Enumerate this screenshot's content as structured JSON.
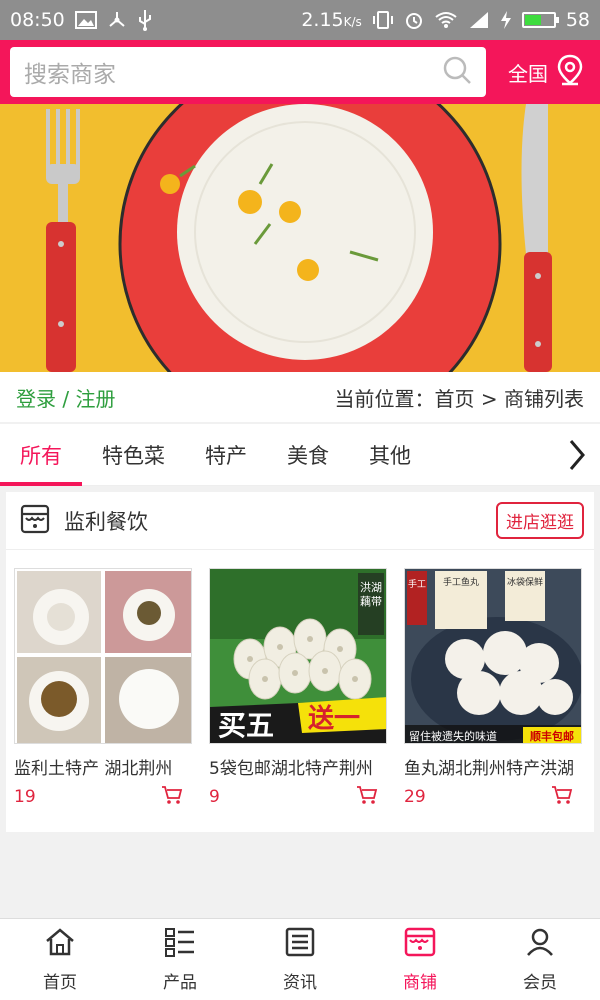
{
  "status_bar": {
    "time": "08:50",
    "speed": "2.15",
    "speed_unit": "K/s",
    "battery": "58",
    "battery_fraction": 0.58
  },
  "header": {
    "search_placeholder": "搜索商家",
    "region_label": "全国",
    "accent_color": "#f4165a"
  },
  "banner": {},
  "auth": {
    "login_label": "登录 / 注册"
  },
  "breadcrumb": {
    "text": "当前位置：首页 > 商铺列表"
  },
  "tabs": [
    {
      "label": "所有",
      "active": true
    },
    {
      "label": "特色菜"
    },
    {
      "label": "特产"
    },
    {
      "label": "美食"
    },
    {
      "label": "其他"
    }
  ],
  "shop": {
    "name": "监利餐饮",
    "enter_label": "进店逛逛",
    "products": [
      {
        "title": "监利土特产 湖北荆州",
        "price": "19"
      },
      {
        "title": "5袋包邮湖北特产荆州",
        "price": "9",
        "promo_text": "买五送一",
        "side_tag": "洪湖藕带"
      },
      {
        "title": "鱼丸湖北荆州特产洪湖",
        "price": "29",
        "tag_left": "手工鱼丸",
        "tag_right": "冰袋保鲜",
        "bottom_text": "留住被遗失的味道",
        "badge": "顺丰包邮"
      }
    ]
  },
  "bottom_nav": [
    {
      "label": "首页",
      "icon": "home-icon"
    },
    {
      "label": "产品",
      "icon": "list-icon"
    },
    {
      "label": "资讯",
      "icon": "news-icon"
    },
    {
      "label": "商铺",
      "icon": "shop-icon",
      "active": true
    },
    {
      "label": "会员",
      "icon": "user-icon"
    }
  ]
}
